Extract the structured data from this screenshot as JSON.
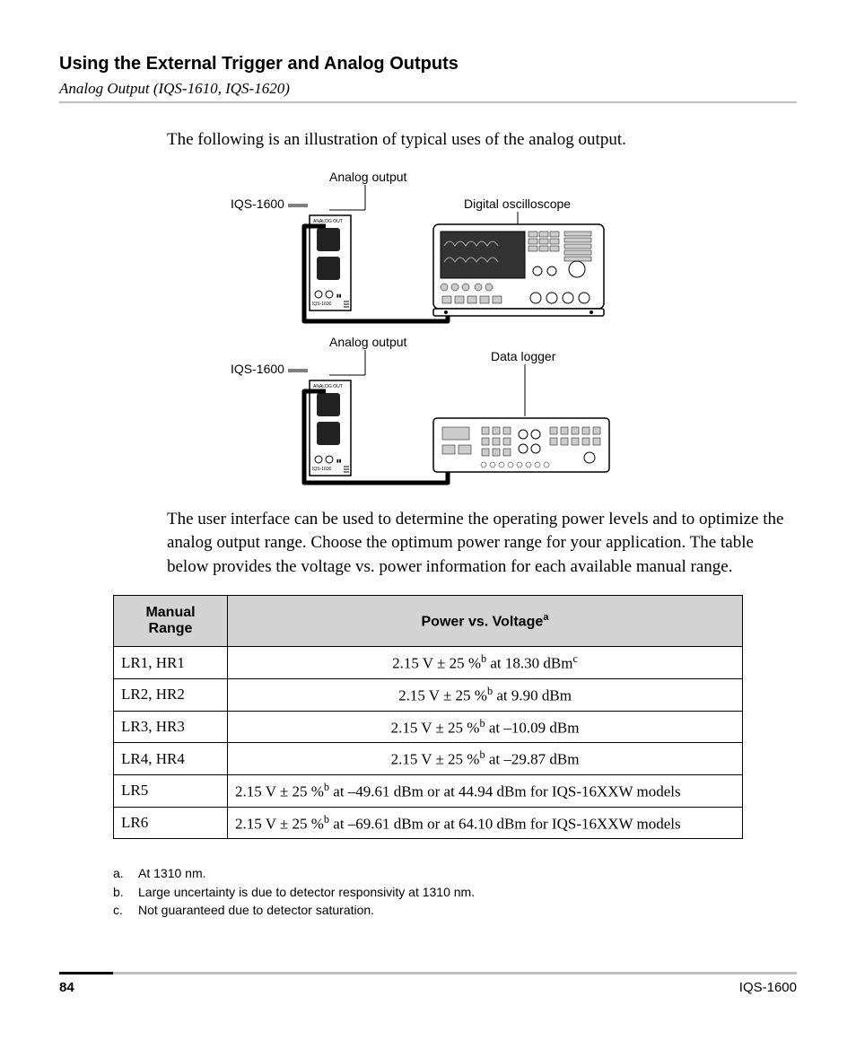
{
  "header": {
    "title": "Using the External Trigger and Analog Outputs",
    "subtitle": "Analog Output (IQS-1610, IQS-1620)"
  },
  "intro": "The following is an illustration of typical uses of the analog output.",
  "diagram": {
    "top": {
      "module_label": "IQS-1600",
      "port_label": "Analog output",
      "device_label": "Digital oscilloscope",
      "module_small_top": "ANALOG OUT",
      "module_small_bottom": "IQS-1600"
    },
    "bottom": {
      "module_label": "IQS-1600",
      "port_label": "Analog output",
      "device_label": "Data logger",
      "module_small_top": "ANALOG OUT",
      "module_small_bottom": "IQS-1600"
    }
  },
  "paragraph2": "The user interface can be used to determine the operating power levels and to optimize the analog output range. Choose the optimum power range for your application. The table below provides the voltage vs. power information for each available manual range.",
  "table": {
    "headers": {
      "col1_l1": "Manual",
      "col1_l2": "Range",
      "col2": "Power vs. Voltage",
      "col2_sup": "a"
    },
    "rows": [
      {
        "range": "LR1, HR1",
        "value_html": "2.15 V ± 25 %<sup>b</sup> at 18.30 dBm<sup>c</sup>"
      },
      {
        "range": "LR2, HR2",
        "value_html": "2.15 V ± 25 %<sup>b</sup> at 9.90 dBm"
      },
      {
        "range": "LR3, HR3",
        "value_html": "2.15 V ± 25 %<sup>b</sup> at –10.09 dBm"
      },
      {
        "range": "LR4, HR4",
        "value_html": "2.15 V ± 25 %<sup>b</sup> at –29.87 dBm"
      },
      {
        "range": "LR5",
        "value_html": "2.15 V ± 25 %<sup>b</sup> at –49.61 dBm or at 44.94 dBm for IQS-16XXW models"
      },
      {
        "range": "LR6",
        "value_html": "2.15 V ± 25 %<sup>b</sup> at –69.61 dBm or at 64.10 dBm for IQS-16XXW models"
      }
    ]
  },
  "footnotes": [
    {
      "key": "a.",
      "text": "At 1310 nm."
    },
    {
      "key": "b.",
      "text": "Large uncertainty is due to detector responsivity at 1310 nm."
    },
    {
      "key": "c.",
      "text": "Not guaranteed due to detector saturation."
    }
  ],
  "footer": {
    "page": "84",
    "model": "IQS-1600"
  }
}
